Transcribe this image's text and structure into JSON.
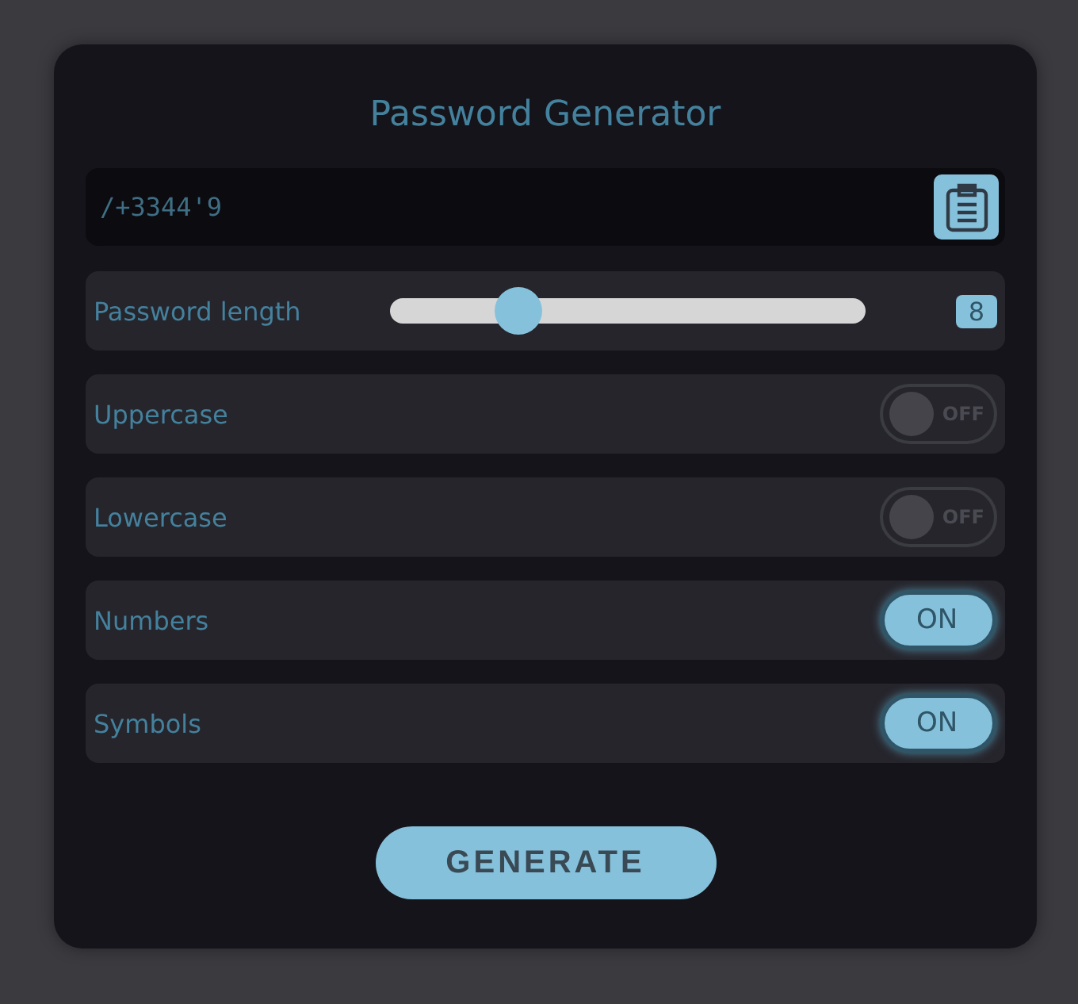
{
  "title": "Password Generator",
  "password": {
    "value": "/+3344'9"
  },
  "length": {
    "label": "Password length",
    "level": 0.27,
    "value": "8"
  },
  "options": [
    {
      "label": "Uppercase",
      "on": false,
      "state_label": "OFF"
    },
    {
      "label": "Lowercase",
      "on": false,
      "state_label": "OFF"
    },
    {
      "label": "Numbers",
      "on": true,
      "state_label": "ON"
    },
    {
      "label": "Symbols",
      "on": true,
      "state_label": "ON"
    }
  ],
  "button": "GENERATE"
}
